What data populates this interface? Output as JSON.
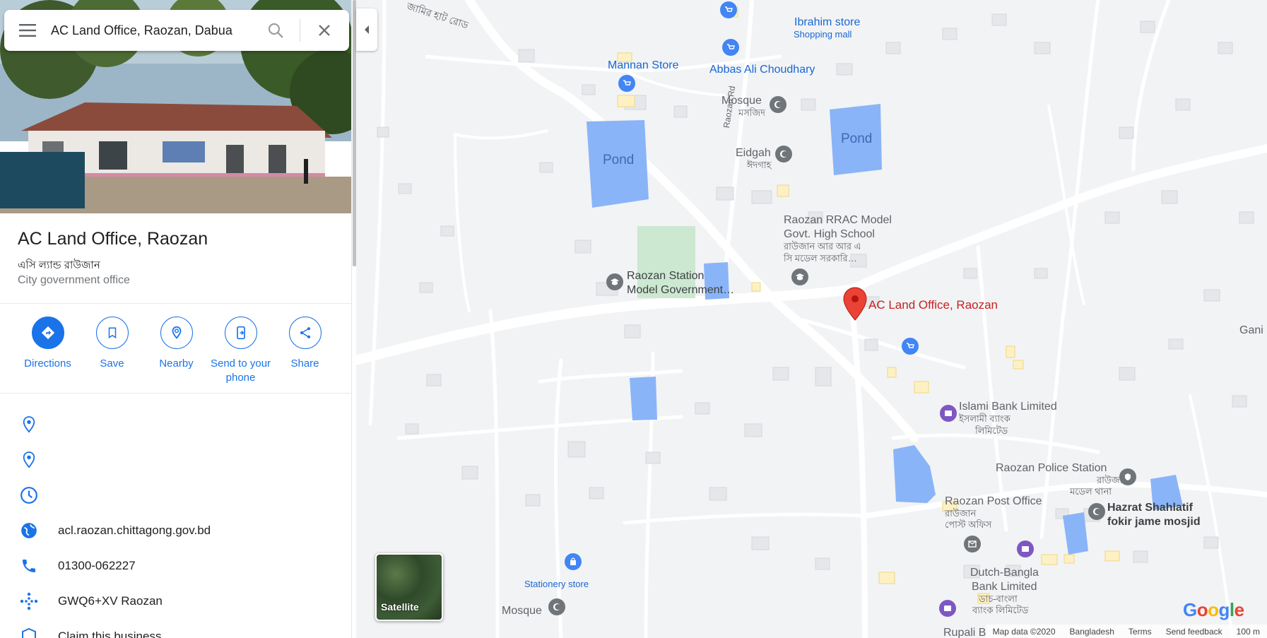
{
  "search": {
    "value": "AC Land Office, Raozan, Dabua"
  },
  "place": {
    "title": "AC Land Office, Raozan",
    "native_name": "এসি ল্যান্ড রাউজান",
    "category": "City government office"
  },
  "actions": [
    {
      "label": "Directions",
      "icon": "directions-icon"
    },
    {
      "label": "Save",
      "icon": "bookmark-icon"
    },
    {
      "label": "Nearby",
      "icon": "nearby-icon"
    },
    {
      "label": "Send to your phone",
      "icon": "send-to-phone-icon"
    },
    {
      "label": "Share",
      "icon": "share-icon"
    }
  ],
  "info": {
    "address": "",
    "located_in": "",
    "hours": "",
    "website": "acl.raozan.chittagong.gov.bd",
    "phone": "01300-062227",
    "plus_code": "GWQ6+XV Raozan",
    "claim": "Claim this business"
  },
  "map": {
    "road_top_bangla": "জামির হাট রোড",
    "road_raozan": "Raozan Rd",
    "pond_label": "Pond",
    "selected_label": "AC Land Office, Raozan",
    "labels": {
      "ibrahim_store": "Ibrahim store",
      "shopping_mall": "Shopping mall",
      "mannan_store": "Mannan Store",
      "abbas": "Abbas Ali Choudhary",
      "mosque1": "Mosque",
      "mosque1_bn": "মসজিদ",
      "eidgah": "Eidgah",
      "eidgah_bn": "ঈদগাহ",
      "school": "Raozan RRAC Model",
      "school2": "Govt. High School",
      "school_bn": "রাউজান আর আর এ",
      "school_bn2": "সি মডেল সরকারি…",
      "station_school": "Raozan Station",
      "station_school2": "Model Government…",
      "gani": "Gani Ha",
      "islami_bank": "Islami Bank Limited",
      "islami_bank_bn": "ইসলামী ব্যাংক",
      "islami_bank_bn2": "লিমিটেড",
      "police": "Raozan Police Station",
      "police_bn": "রাউজান",
      "police_bn2": "মডেল থানা",
      "post": "Raozan Post Office",
      "post_bn": "রাউজান",
      "post_bn2": "পোস্ট অফিস",
      "hazrat": "Hazrat Shahlatif",
      "hazrat2": "fokir jame mosjid",
      "dbbl": "Dutch-Bangla",
      "dbbl2": "Bank Limited",
      "dbbl_bn": "ডাচ-বাংলা",
      "dbbl_bn2": "ব্যাংক লিমিটেড",
      "stationery": "Stationery store",
      "mosque2": "Mosque",
      "rupali": "Rupali B"
    },
    "satellite_label": "Satellite",
    "google_logo": [
      "G",
      "o",
      "o",
      "g",
      "l",
      "e"
    ],
    "google_colors": [
      "#4285f4",
      "#ea4335",
      "#fbbc05",
      "#4285f4",
      "#34a853",
      "#ea4335"
    ],
    "footer": {
      "map_data": "Map data ©2020",
      "country": "Bangladesh",
      "terms": "Terms",
      "feedback": "Send feedback",
      "scale": "100 m"
    }
  },
  "colors": {
    "accent": "#1a73e8",
    "marker": "#ea4335",
    "water": "#8ab4f8",
    "park": "#cde8d1"
  }
}
